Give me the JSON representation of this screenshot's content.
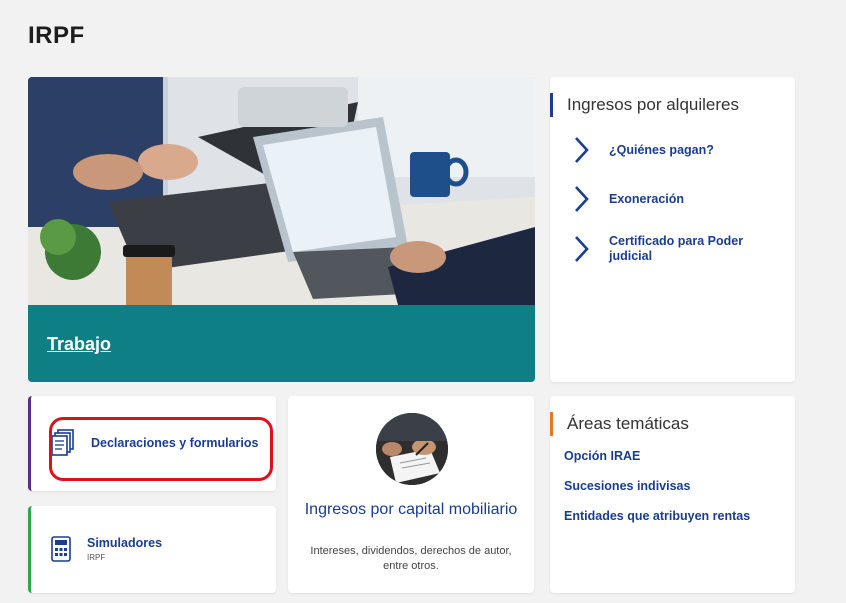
{
  "page": {
    "title": "IRPF"
  },
  "hero": {
    "link_label": "Trabajo",
    "band_color": "#0e7f85"
  },
  "rentals": {
    "heading": "Ingresos por alquileres",
    "links": [
      {
        "label": "¿Quiénes pagan?"
      },
      {
        "label": "Exoneración"
      },
      {
        "label": "Certificado para Poder judicial"
      }
    ]
  },
  "declarations": {
    "label": "Declaraciones y formularios",
    "icon": "documents-icon",
    "accent": "#5b2d8a",
    "highlight_color": "#e0101b"
  },
  "simulators": {
    "label": "Simuladores",
    "sublabel": "IRPF",
    "icon": "calculator-icon",
    "accent": "#2ca84a"
  },
  "capital": {
    "title": "Ingresos por capital mobiliario",
    "description": "Intereses, dividendos, derechos de autor, entre otros."
  },
  "areas": {
    "heading": "Áreas temáticas",
    "links": [
      {
        "label": "Opción IRAE"
      },
      {
        "label": "Sucesiones indivisas"
      },
      {
        "label": "Entidades que atribuyen rentas"
      }
    ]
  },
  "colors": {
    "link": "#1a3d8f",
    "orange_accent": "#e87722",
    "blue_accent": "#1a3d8f"
  }
}
